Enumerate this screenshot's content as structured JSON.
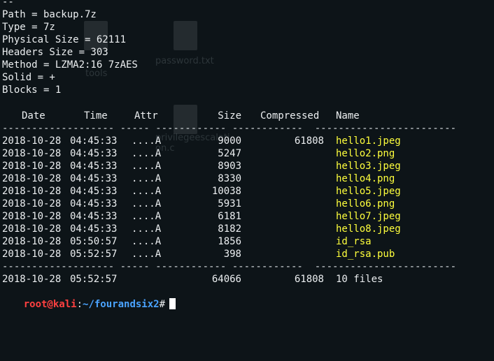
{
  "desktop": {
    "icons": [
      {
        "name": "password-file-icon",
        "label": "password.txt"
      },
      {
        "name": "tools-folder-icon",
        "label": "tools"
      },
      {
        "name": "privesc-file-icon",
        "label": "privilegeescalati on.c"
      }
    ]
  },
  "terminal": {
    "top_line": "--",
    "info": [
      "Path = backup.7z",
      "Type = 7z",
      "Physical Size = 62111",
      "Headers Size = 303",
      "Method = LZMA2:16 7zAES",
      "Solid = +",
      "Blocks = 1"
    ],
    "columns": {
      "date": "Date",
      "time": "Time",
      "attr": "Attr",
      "size": "Size",
      "compressed": "Compressed",
      "name": "Name"
    },
    "separator": "------------------- ----- ------------ ------------  ------------------------",
    "rows": [
      {
        "date": "2018-10-28",
        "time": "04:45:33",
        "attr": "....A",
        "size": "9000",
        "compressed": "61808",
        "name": "hello1.jpeg"
      },
      {
        "date": "2018-10-28",
        "time": "04:45:33",
        "attr": "....A",
        "size": "5247",
        "compressed": "",
        "name": "hello2.png"
      },
      {
        "date": "2018-10-28",
        "time": "04:45:33",
        "attr": "....A",
        "size": "8903",
        "compressed": "",
        "name": "hello3.jpeg"
      },
      {
        "date": "2018-10-28",
        "time": "04:45:33",
        "attr": "....A",
        "size": "8330",
        "compressed": "",
        "name": "hello4.png"
      },
      {
        "date": "2018-10-28",
        "time": "04:45:33",
        "attr": "....A",
        "size": "10038",
        "compressed": "",
        "name": "hello5.jpeg"
      },
      {
        "date": "2018-10-28",
        "time": "04:45:33",
        "attr": "....A",
        "size": "5931",
        "compressed": "",
        "name": "hello6.png"
      },
      {
        "date": "2018-10-28",
        "time": "04:45:33",
        "attr": "....A",
        "size": "6181",
        "compressed": "",
        "name": "hello7.jpeg"
      },
      {
        "date": "2018-10-28",
        "time": "04:45:33",
        "attr": "....A",
        "size": "8182",
        "compressed": "",
        "name": "hello8.jpeg"
      },
      {
        "date": "2018-10-28",
        "time": "05:50:57",
        "attr": "....A",
        "size": "1856",
        "compressed": "",
        "name": "id_rsa"
      },
      {
        "date": "2018-10-28",
        "time": "05:52:57",
        "attr": "....A",
        "size": "398",
        "compressed": "",
        "name": "id_rsa.pub"
      }
    ],
    "summary": {
      "date": "2018-10-28",
      "time": "05:52:57",
      "size": "64066",
      "compressed": "61808",
      "name": "10 files"
    },
    "prompt": {
      "user_host": "root@kali",
      "sep": ":",
      "path": "~/fourandsix2",
      "symbol": "#"
    }
  },
  "colors": {
    "background": "#0d1418",
    "text": "#eceff1",
    "highlight": "#ffff3c",
    "prompt_user": "#ff4040",
    "prompt_path": "#4aa3ff"
  }
}
